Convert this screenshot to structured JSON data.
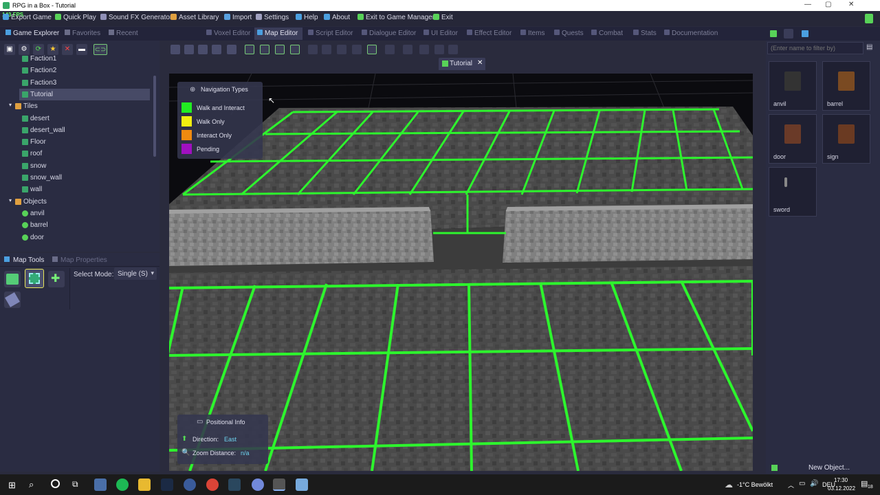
{
  "window": {
    "title": "RPG in a Box - Tutorial",
    "fps": "143 FPS"
  },
  "menu": [
    {
      "label": "Export Game",
      "color": "#4b9fe0"
    },
    {
      "label": "Quick Play",
      "color": "#58d258"
    },
    {
      "label": "Sound FX Generator",
      "color": "#9090b8"
    },
    {
      "label": "Asset Library",
      "color": "#e0a040"
    },
    {
      "label": "Import",
      "color": "#58a0e0"
    },
    {
      "label": "Settings",
      "color": "#a0a0c0"
    },
    {
      "label": "Help",
      "color": "#4b9fe0"
    },
    {
      "label": "About",
      "color": "#4b9fe0"
    },
    {
      "label": "Exit to Game Manager",
      "color": "#58d258"
    },
    {
      "label": "Exit",
      "color": "#58d258"
    }
  ],
  "left_tabs": [
    "Game Explorer",
    "Favorites",
    "Recent"
  ],
  "editor_tabs": [
    "Voxel Editor",
    "Map Editor",
    "Script Editor",
    "Dialogue Editor",
    "UI Editor",
    "Effect Editor",
    "Items",
    "Quests",
    "Combat",
    "Stats",
    "Documentation"
  ],
  "active_editor_tab": "Map Editor",
  "tree": [
    {
      "label": "Faction1",
      "kind": "map",
      "depth": 2
    },
    {
      "label": "Faction2",
      "kind": "map",
      "depth": 2
    },
    {
      "label": "Faction3",
      "kind": "map",
      "depth": 2
    },
    {
      "label": "Tutorial",
      "kind": "map",
      "depth": 2,
      "selected": true
    },
    {
      "label": "Tiles",
      "kind": "folder",
      "depth": 1
    },
    {
      "label": "desert",
      "kind": "tile",
      "depth": 2
    },
    {
      "label": "desert_wall",
      "kind": "tile",
      "depth": 2
    },
    {
      "label": "Floor",
      "kind": "tile",
      "depth": 2
    },
    {
      "label": "roof",
      "kind": "tile",
      "depth": 2
    },
    {
      "label": "snow",
      "kind": "tile",
      "depth": 2
    },
    {
      "label": "snow_wall",
      "kind": "tile",
      "depth": 2
    },
    {
      "label": "wall",
      "kind": "tile",
      "depth": 2
    },
    {
      "label": "Objects",
      "kind": "folder",
      "depth": 1
    },
    {
      "label": "anvil",
      "kind": "object",
      "depth": 2
    },
    {
      "label": "barrel",
      "kind": "object",
      "depth": 2
    },
    {
      "label": "door",
      "kind": "object",
      "depth": 2
    }
  ],
  "map_tools": {
    "tab1": "Map Tools",
    "tab2": "Map Properties",
    "select_mode_label": "Select Mode:",
    "select_mode_value": "Single (S)"
  },
  "map_tab": {
    "label": "Tutorial"
  },
  "nav_types": {
    "title": "Navigation Types",
    "items": [
      {
        "label": "Walk and Interact",
        "color": "#22ee22"
      },
      {
        "label": "Walk Only",
        "color": "#f2ee10"
      },
      {
        "label": "Interact Only",
        "color": "#f08a10"
      },
      {
        "label": "Pending",
        "color": "#a010c0"
      }
    ]
  },
  "positional": {
    "title": "Positional Info",
    "direction_label": "Direction:",
    "direction_value": "East",
    "zoom_label": "Zoom Distance:",
    "zoom_value": "n/a"
  },
  "filter": {
    "placeholder": "(Enter name to filter by)"
  },
  "objects": [
    "anvil",
    "barrel",
    "door",
    "sign",
    "sword"
  ],
  "new_object": "New Object...",
  "taskbar": {
    "weather": "-1°C  Bewölkt",
    "lang": "DEU",
    "time": "17:30",
    "date": "03.12.2022",
    "notif": "18"
  }
}
